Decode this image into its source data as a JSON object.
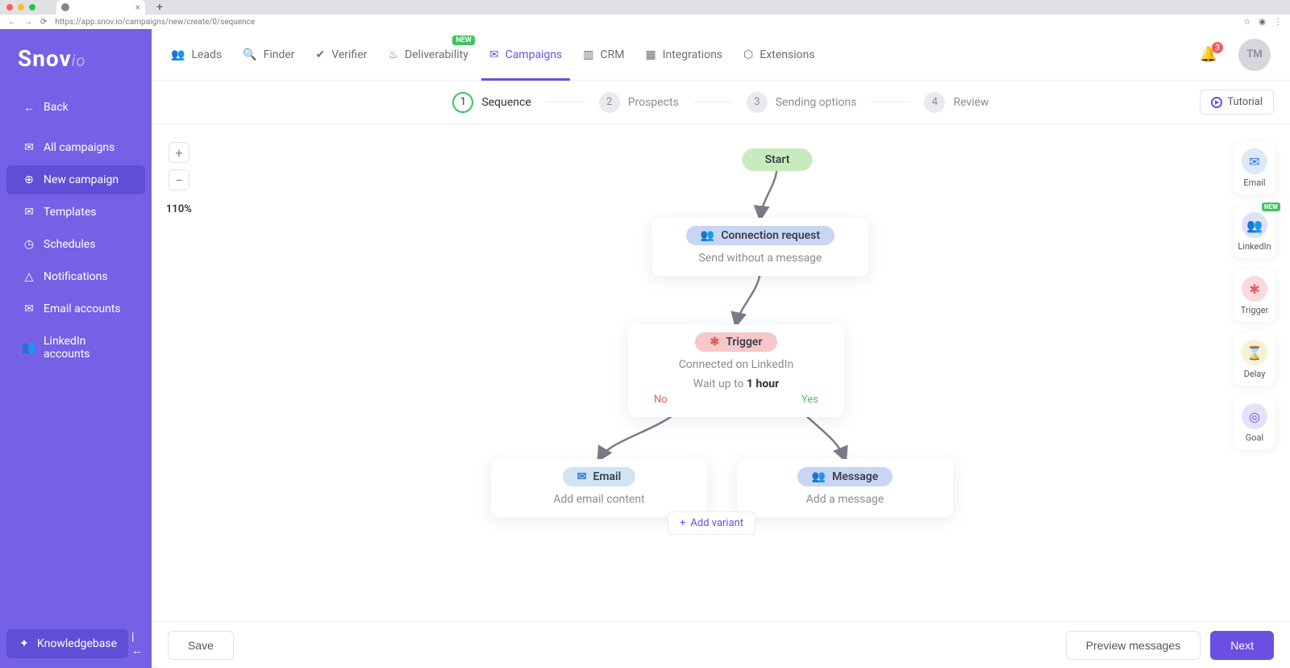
{
  "browser": {
    "url": "https://app.snov.io/campaigns/new/create/0/sequence",
    "star_icon": "☆",
    "user_icon": "person",
    "menu_icon": "⋮"
  },
  "brand": {
    "name": "Snov",
    "suffix": "io"
  },
  "topnav": {
    "items": [
      {
        "label": "Leads"
      },
      {
        "label": "Finder"
      },
      {
        "label": "Verifier"
      },
      {
        "label": "Deliverability",
        "badge": "NEW"
      },
      {
        "label": "Campaigns",
        "active": true
      },
      {
        "label": "CRM"
      },
      {
        "label": "Integrations"
      },
      {
        "label": "Extensions"
      }
    ],
    "bell_count": "3",
    "avatar": "TM"
  },
  "sidebar": {
    "back": "Back",
    "items": [
      {
        "label": "All campaigns"
      },
      {
        "label": "New campaign",
        "active": true
      },
      {
        "label": "Templates"
      },
      {
        "label": "Schedules"
      },
      {
        "label": "Notifications"
      },
      {
        "label": "Email accounts"
      },
      {
        "label": "LinkedIn accounts"
      }
    ],
    "knowledge": "Knowledgebase"
  },
  "wizard": {
    "steps": [
      {
        "num": "1",
        "label": "Sequence"
      },
      {
        "num": "2",
        "label": "Prospects"
      },
      {
        "num": "3",
        "label": "Sending options"
      },
      {
        "num": "4",
        "label": "Review"
      }
    ],
    "tutorial": "Tutorial"
  },
  "zoom": {
    "level": "110%"
  },
  "palette": {
    "items": [
      {
        "label": "Email",
        "bg": "#dce9f6"
      },
      {
        "label": "LinkedIn",
        "bg": "#dbe3f7",
        "badge": "NEW"
      },
      {
        "label": "Trigger",
        "bg": "#fadadb"
      },
      {
        "label": "Delay",
        "bg": "#faf0d4"
      },
      {
        "label": "Goal",
        "bg": "#e6e1fb"
      }
    ]
  },
  "flow": {
    "start": "Start",
    "conn": {
      "title": "Connection request",
      "sub": "Send without a message"
    },
    "trigger": {
      "title": "Trigger",
      "sub": "Connected on LinkedIn",
      "wait_prefix": "Wait up to ",
      "wait_bold": "1 hour",
      "no": "No",
      "yes": "Yes"
    },
    "email": {
      "title": "Email",
      "sub": "Add email content"
    },
    "msg": {
      "title": "Message",
      "sub": "Add a message"
    },
    "add_variant": "Add variant"
  },
  "footer": {
    "save": "Save",
    "preview": "Preview messages",
    "next": "Next"
  }
}
